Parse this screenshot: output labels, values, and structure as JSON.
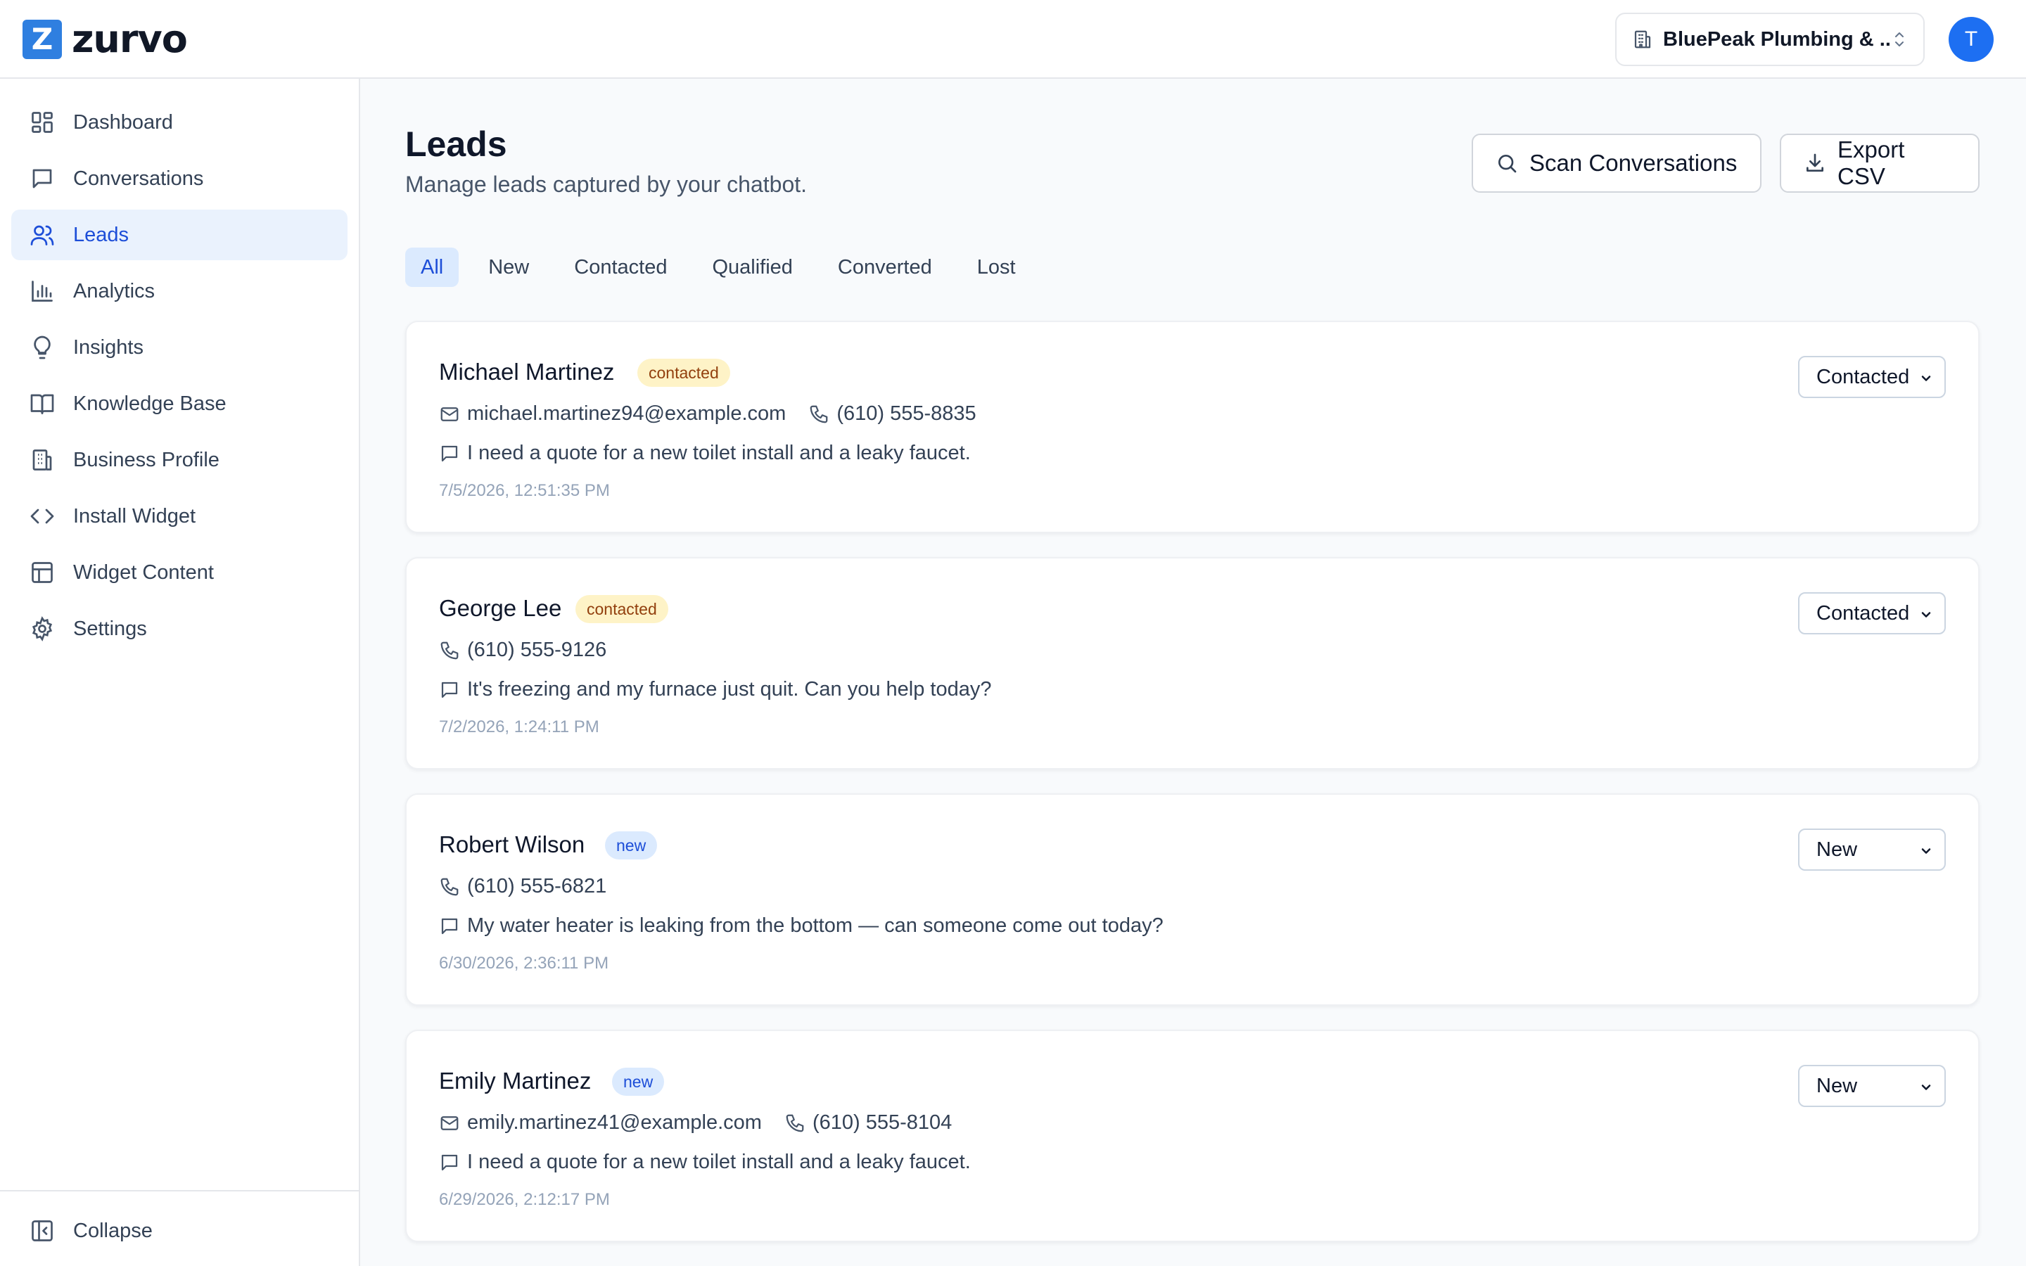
{
  "brand": {
    "name": "zurvo",
    "mark": "Z"
  },
  "header": {
    "business": "BluePeak Plumbing & ...",
    "avatar_initial": "T"
  },
  "sidebar": {
    "items": [
      {
        "label": "Dashboard",
        "icon": "grid-icon"
      },
      {
        "label": "Conversations",
        "icon": "chat-icon"
      },
      {
        "label": "Leads",
        "icon": "users-icon",
        "active": true
      },
      {
        "label": "Analytics",
        "icon": "bar-chart-icon"
      },
      {
        "label": "Insights",
        "icon": "lightbulb-icon"
      },
      {
        "label": "Knowledge Base",
        "icon": "book-icon"
      },
      {
        "label": "Business Profile",
        "icon": "building-icon"
      },
      {
        "label": "Install Widget",
        "icon": "code-icon"
      },
      {
        "label": "Widget Content",
        "icon": "layout-icon"
      },
      {
        "label": "Settings",
        "icon": "gear-icon"
      }
    ],
    "collapse_label": "Collapse"
  },
  "page": {
    "title": "Leads",
    "subtitle": "Manage leads captured by your chatbot.",
    "scan_label": "Scan Conversations",
    "export_label": "Export CSV"
  },
  "filters": {
    "tabs": [
      "All",
      "New",
      "Contacted",
      "Qualified",
      "Converted",
      "Lost"
    ],
    "active": "All"
  },
  "leads": [
    {
      "name": "Michael Martinez",
      "badge": "contacted",
      "email": "michael.martinez94@example.com",
      "phone": "(610) 555-8835",
      "message": "I need a quote for a new toilet install and a leaky faucet.",
      "timestamp": "7/5/2026, 12:51:35 PM",
      "status": "Contacted"
    },
    {
      "name": "George Lee",
      "badge": "contacted",
      "email": "",
      "phone": "(610) 555-9126",
      "message": "It's freezing and my furnace just quit. Can you help today?",
      "timestamp": "7/2/2026, 1:24:11 PM",
      "status": "Contacted"
    },
    {
      "name": "Robert Wilson",
      "badge": "new",
      "email": "",
      "phone": "(610) 555-6821",
      "message": "My water heater is leaking from the bottom — can someone come out today?",
      "timestamp": "6/30/2026, 2:36:11 PM",
      "status": "New"
    },
    {
      "name": "Emily Martinez",
      "badge": "new",
      "email": "emily.martinez41@example.com",
      "phone": "(610) 555-8104",
      "message": "I need a quote for a new toilet install and a leaky faucet.",
      "timestamp": "6/29/2026, 2:12:17 PM",
      "status": "New"
    }
  ],
  "colors": {
    "accent": "#1d4ed8",
    "brand": "#2f7fe0",
    "avatar": "#1d6ff2"
  }
}
